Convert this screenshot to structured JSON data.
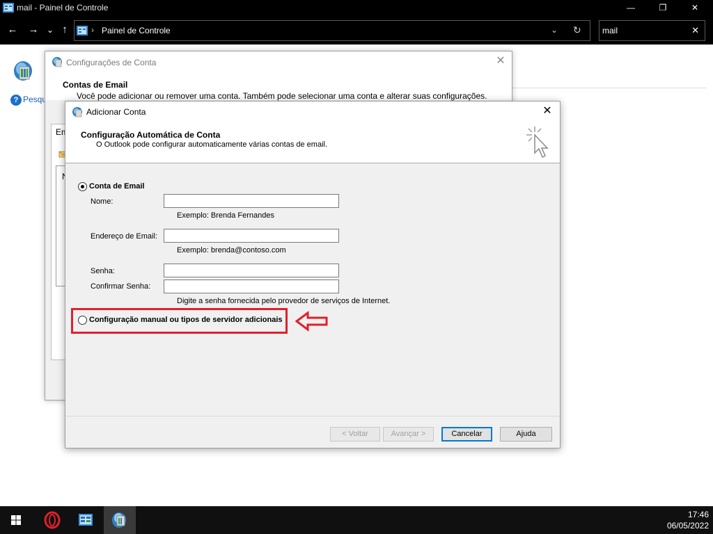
{
  "window": {
    "title": "mail - Painel de Controle",
    "minimize": "—",
    "maximize": "❐",
    "close": "✕"
  },
  "nav": {
    "back": "←",
    "forward": "→",
    "recent": "⌄",
    "up": "↑",
    "address_separator": "›",
    "address": "Painel de Controle",
    "address_dropdown": "⌄",
    "refresh": "↻",
    "search_value": "mail",
    "search_clear": "✕"
  },
  "control_panel": {
    "help_symbol": "?",
    "help_link": "Pesqu"
  },
  "account_settings": {
    "title": "Configurações de Conta",
    "close": "✕",
    "header_title": "Contas de Email",
    "header_subtitle": "Você pode adicionar ou remover uma conta. Também pode selecionar uma conta e alterar suas configurações.",
    "tab_partial": "Em",
    "list_partial": "N"
  },
  "add_account": {
    "title": "Adicionar Conta",
    "close": "✕",
    "header_title": "Configuração Automática de Conta",
    "header_subtitle": "O Outlook pode configurar automaticamente várias contas de email.",
    "option_email": "Conta de Email",
    "name_label": "Nome:",
    "name_value": "",
    "name_hint": "Exemplo: Brenda Fernandes",
    "email_label": "Endereço de Email:",
    "email_value": "",
    "email_hint": "Exemplo: brenda@contoso.com",
    "password_label": "Senha:",
    "password_value": "",
    "confirm_label": "Confirmar Senha:",
    "confirm_value": "",
    "password_hint": "Digite a senha fornecida pelo provedor de serviços de Internet.",
    "option_manual": "Configuração manual ou tipos de servidor adicionais",
    "selected_option": "Conta de Email",
    "buttons": {
      "back": "< Voltar",
      "next": "Avançar >",
      "cancel": "Cancelar",
      "help": "Ajuda"
    }
  },
  "annotation_color": "#e0202a",
  "taskbar": {
    "time": "17:46",
    "date": "06/05/2022"
  }
}
